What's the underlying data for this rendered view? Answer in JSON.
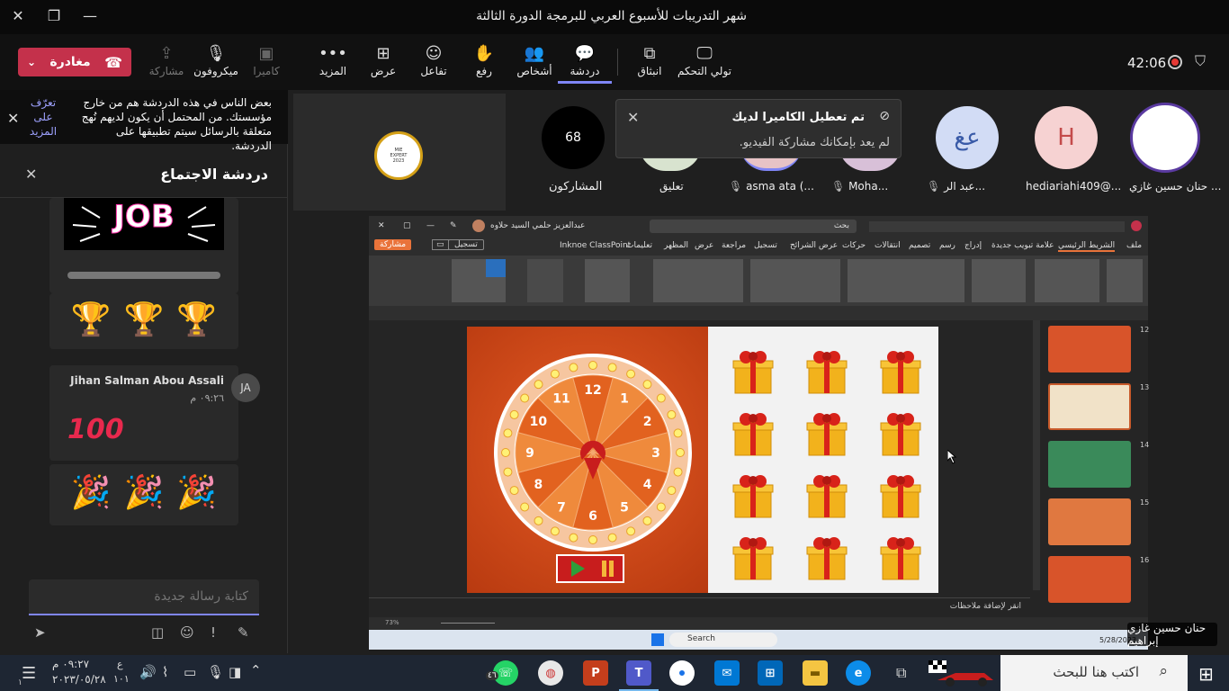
{
  "window": {
    "title": "شهر التدريبات للأسبوع العربي للبرمجة الدورة الثالثة"
  },
  "toolbar": {
    "leave_label": "مغادرة",
    "share_label": "مشاركة",
    "mic_label": "ميكروفون",
    "camera_label": "كاميرا",
    "more_label": "المزيد",
    "view_label": "عرض",
    "react_label": "تفاعل",
    "raise_label": "رفع",
    "people_label": "أشخاص",
    "chat_label": "دردشة",
    "popout_label": "انبثاق",
    "control_label": "تولي التحكم",
    "timer": "42:06"
  },
  "chat_panel": {
    "notice_text": "بعض الناس في هذه الدردشة هم من خارج مؤسستك. من المحتمل أن يكون لديهم نُهج متعلقة بالرسائل سيتم تطبيقها على الدردشة.",
    "notice_link": "تعرّف على المزيد",
    "title": "دردشة الاجتماع",
    "messages": [
      {
        "sender": "Jihan Salman Abou Assali",
        "initials": "JA",
        "time": "٠٩:٢٦ م"
      }
    ],
    "composer_placeholder": "كتابة رسالة جديدة"
  },
  "participants": {
    "count": "68",
    "count_label": "المشاركون",
    "names": [
      "تعليق",
      "asma ata (...",
      "Moha...",
      "عبد الر...",
      "hediariahi409@...",
      "حنان حسين غازي ..."
    ],
    "initials_abd": "عغ",
    "initials_h": "H"
  },
  "toast": {
    "title": "تم تعطيل الكاميرا لديك",
    "body": "لم يعد بإمكانك مشاركة الفيديو."
  },
  "shared_screen": {
    "ppt_tabs": [
      "ملف",
      "الشريط الرئيسي",
      "علامة تبويب جديدة",
      "إدراج",
      "رسم",
      "تصميم",
      "انتقالات",
      "حركات",
      "عرض الشرائح",
      "تسجيل",
      "مراجعة",
      "عرض",
      "المظهر",
      "تعليمات",
      "Inknoe ClassPoint"
    ],
    "record_btn": "تسجيل",
    "share_btn": "مشاركة",
    "search_placeholder": "بحث",
    "author": "عبدالعزيز حلمي السيد حلاوه",
    "wheel_numbers": [
      "12",
      "1",
      "2",
      "3",
      "4",
      "5",
      "6",
      "7",
      "8",
      "9",
      "10",
      "11"
    ],
    "notes_placeholder": "انقر لإضافة ملاحظات",
    "thumbnails": [
      "12",
      "13",
      "14",
      "15",
      "16"
    ],
    "zoom": "73%",
    "taskbar_search": "Search",
    "taskbar_date": "5/28/2023"
  },
  "presenter_name": "حنان حسين غازي إبراهيم",
  "windows_taskbar": {
    "search_placeholder": "اكتب هنا للبحث",
    "time": "٠٩:٢٧ م",
    "date": "٢٠٢٣/٠٥/٢٨",
    "lang": "ع",
    "lang2": "١٠١",
    "notif_count": "١",
    "whatsapp_badge": "٤٦"
  }
}
